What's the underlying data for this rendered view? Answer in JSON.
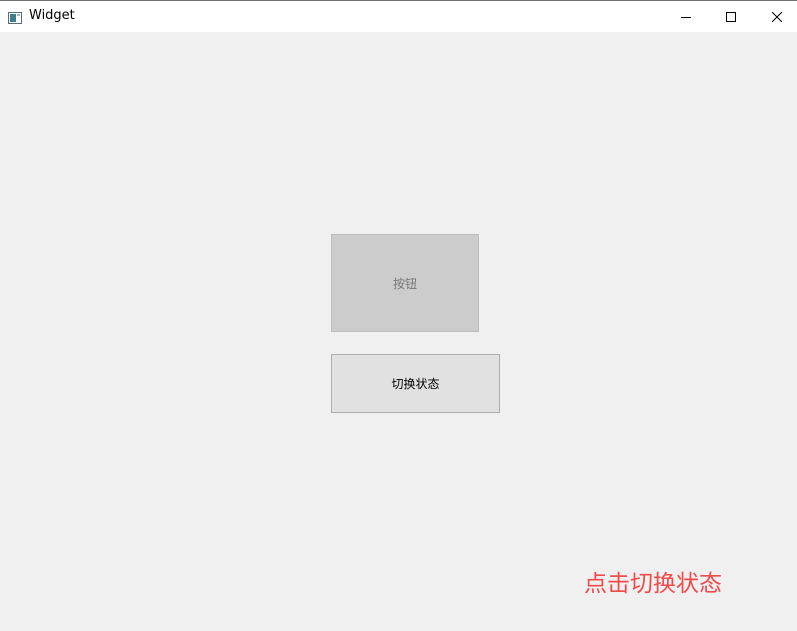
{
  "window": {
    "title": "Widget",
    "app_icon": "app-window-icon",
    "controls": {
      "minimize_icon": "minimize-icon",
      "maximize_icon": "maximize-icon",
      "close_icon": "close-icon"
    }
  },
  "main": {
    "disabled_button_label": "按钮",
    "toggle_button_label": "切换状态",
    "hint_text": "点击切换状态"
  },
  "colors": {
    "hint": "#f04b4b",
    "disabled_button_bg": "#cccccc",
    "toggle_button_bg": "#e1e1e1",
    "client_bg": "#f0f0f0"
  }
}
